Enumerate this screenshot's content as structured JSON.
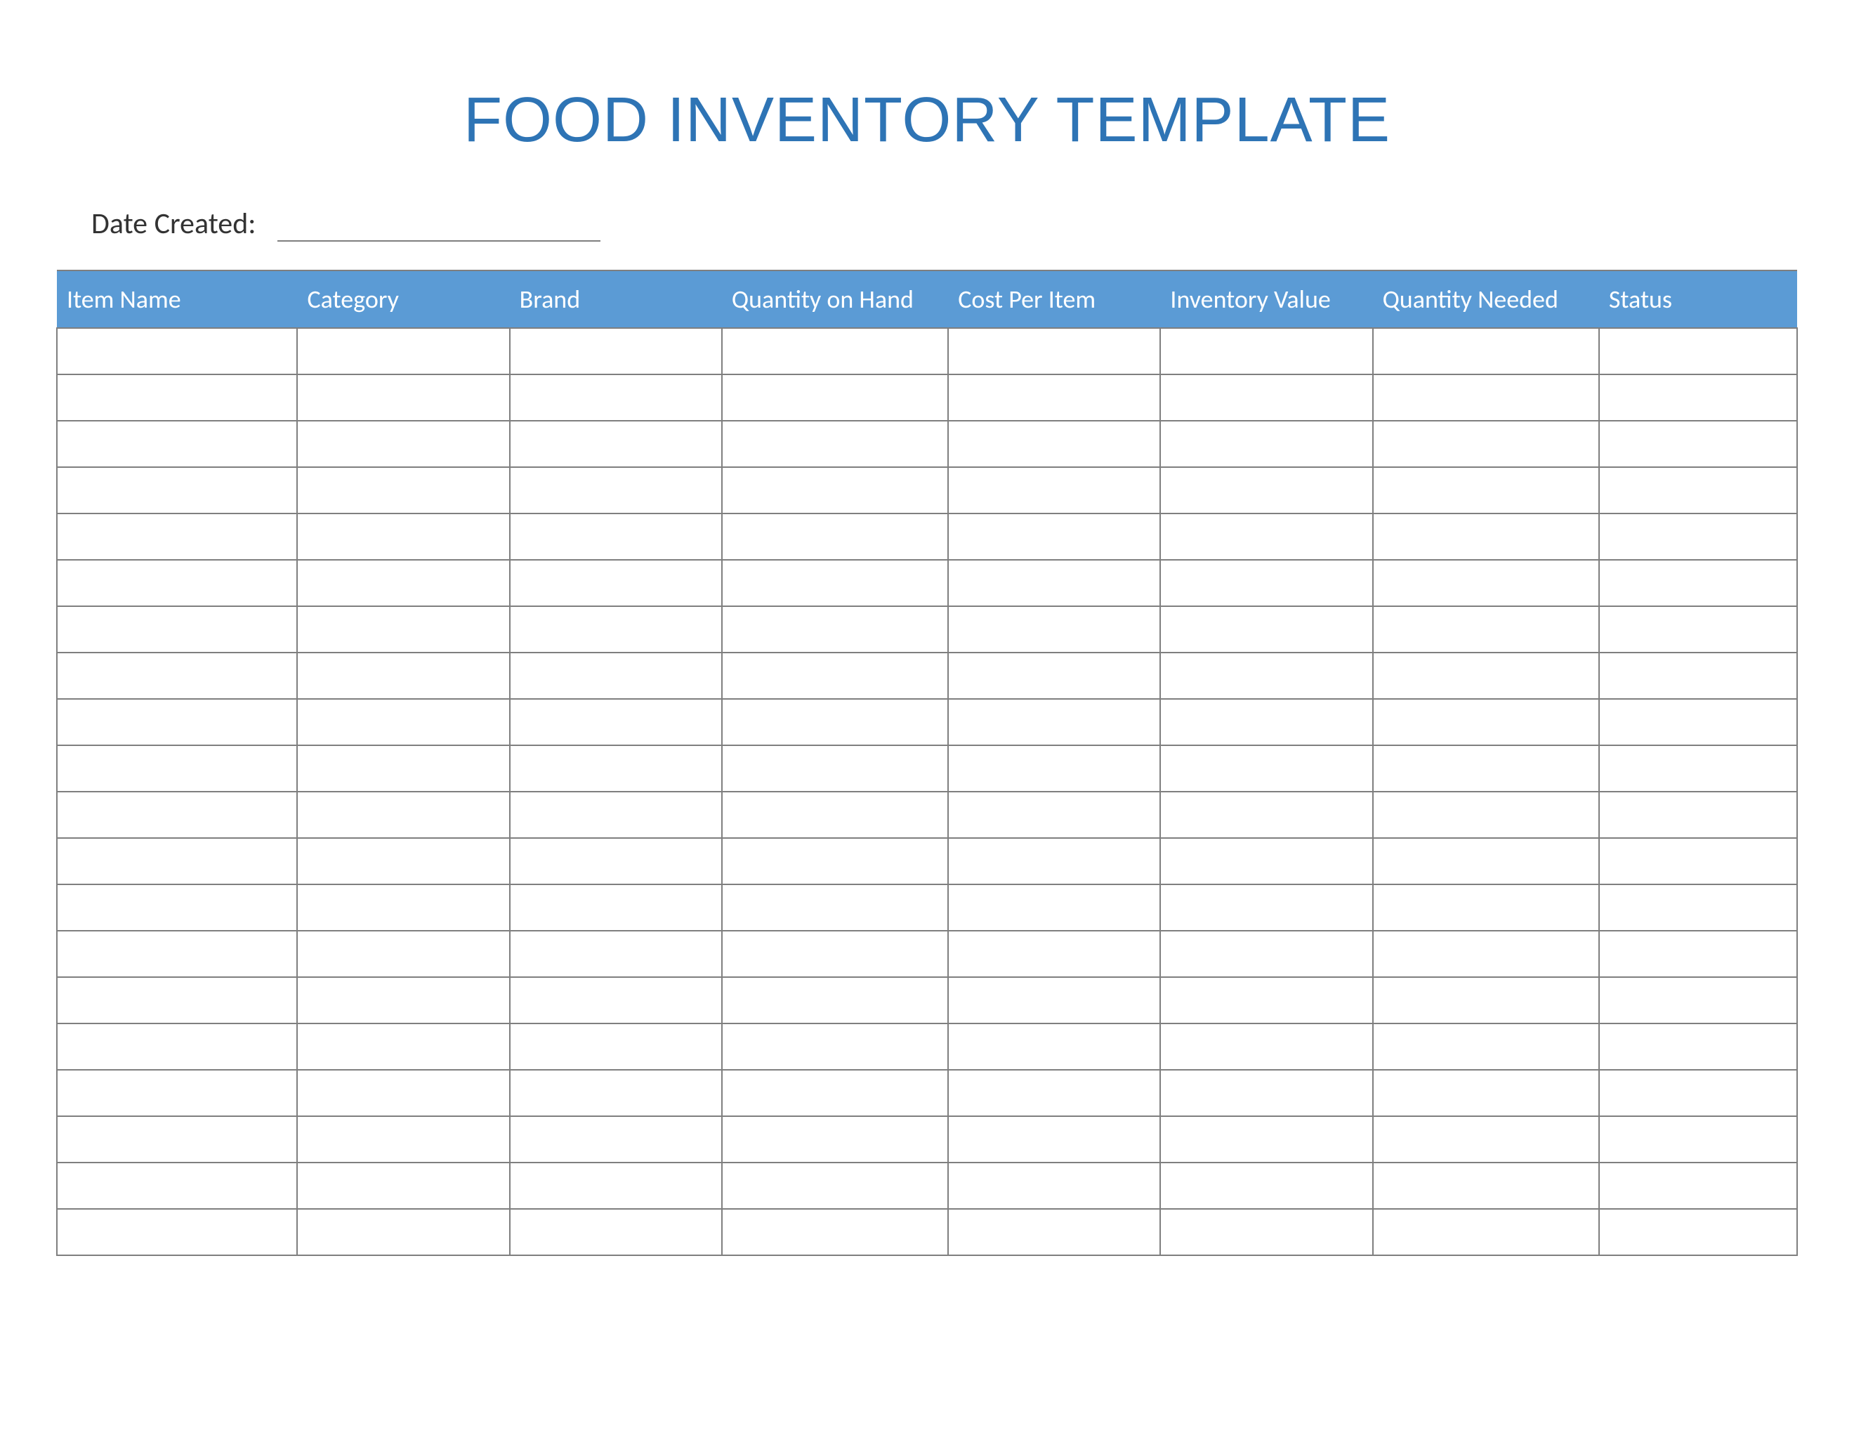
{
  "title": "FOOD INVENTORY TEMPLATE",
  "date_label": "Date Created:",
  "date_value": "",
  "columns": [
    "Item Name",
    "Category",
    "Brand",
    "Quantity on Hand",
    "Cost Per Item",
    "Inventory Value",
    "Quantity Needed",
    "Status"
  ],
  "rows": [
    [
      "",
      "",
      "",
      "",
      "",
      "",
      "",
      ""
    ],
    [
      "",
      "",
      "",
      "",
      "",
      "",
      "",
      ""
    ],
    [
      "",
      "",
      "",
      "",
      "",
      "",
      "",
      ""
    ],
    [
      "",
      "",
      "",
      "",
      "",
      "",
      "",
      ""
    ],
    [
      "",
      "",
      "",
      "",
      "",
      "",
      "",
      ""
    ],
    [
      "",
      "",
      "",
      "",
      "",
      "",
      "",
      ""
    ],
    [
      "",
      "",
      "",
      "",
      "",
      "",
      "",
      ""
    ],
    [
      "",
      "",
      "",
      "",
      "",
      "",
      "",
      ""
    ],
    [
      "",
      "",
      "",
      "",
      "",
      "",
      "",
      ""
    ],
    [
      "",
      "",
      "",
      "",
      "",
      "",
      "",
      ""
    ],
    [
      "",
      "",
      "",
      "",
      "",
      "",
      "",
      ""
    ],
    [
      "",
      "",
      "",
      "",
      "",
      "",
      "",
      ""
    ],
    [
      "",
      "",
      "",
      "",
      "",
      "",
      "",
      ""
    ],
    [
      "",
      "",
      "",
      "",
      "",
      "",
      "",
      ""
    ],
    [
      "",
      "",
      "",
      "",
      "",
      "",
      "",
      ""
    ],
    [
      "",
      "",
      "",
      "",
      "",
      "",
      "",
      ""
    ],
    [
      "",
      "",
      "",
      "",
      "",
      "",
      "",
      ""
    ],
    [
      "",
      "",
      "",
      "",
      "",
      "",
      "",
      ""
    ],
    [
      "",
      "",
      "",
      "",
      "",
      "",
      "",
      ""
    ],
    [
      "",
      "",
      "",
      "",
      "",
      "",
      "",
      ""
    ]
  ],
  "colors": {
    "accent": "#2E74B5",
    "header_bg": "#5B9BD5",
    "border": "#7F7F7F"
  }
}
